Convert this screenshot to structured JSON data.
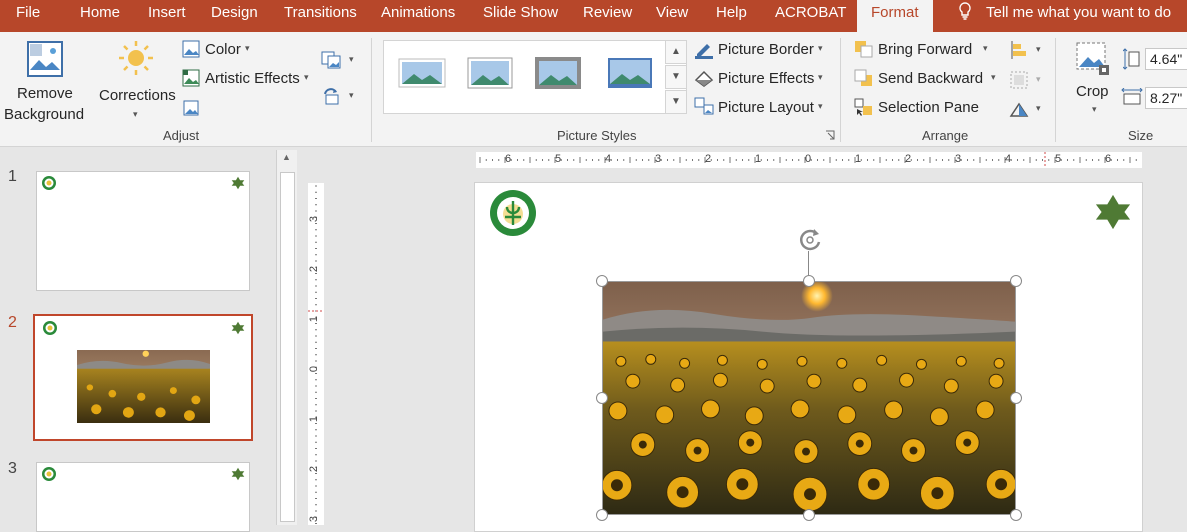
{
  "tabs": [
    "File",
    "Home",
    "Insert",
    "Design",
    "Transitions",
    "Animations",
    "Slide Show",
    "Review",
    "View",
    "Help",
    "ACROBAT"
  ],
  "active_tab": "Format",
  "tell_me": "Tell me what you want to do",
  "adjust": {
    "remove_bg_line1": "Remove",
    "remove_bg_line2": "Background",
    "corrections": "Corrections",
    "color": "Color",
    "artistic_effects": "Artistic Effects",
    "group_label": "Adjust"
  },
  "picture_styles": {
    "border": "Picture Border",
    "effects": "Picture Effects",
    "layout": "Picture Layout",
    "group_label": "Picture Styles"
  },
  "arrange": {
    "bring_forward": "Bring Forward",
    "send_backward": "Send Backward",
    "selection_pane": "Selection Pane",
    "group_label": "Arrange"
  },
  "size": {
    "crop": "Crop",
    "height": "4.64\"",
    "width": "8.27\"",
    "group_label": "Size"
  },
  "slides": [
    {
      "number": "1",
      "has_picture": false
    },
    {
      "number": "2",
      "has_picture": true
    },
    {
      "number": "3",
      "has_picture": false
    }
  ],
  "hruler_labels": [
    "6",
    "5",
    "4",
    "3",
    "2",
    "1",
    "0",
    "1",
    "2",
    "3",
    "4",
    "5",
    "6"
  ],
  "vruler_labels": [
    "3",
    "2",
    "1",
    "0",
    "1",
    "2",
    "3"
  ],
  "colors": {
    "accent": "#b7472a",
    "star": "#4f7a34",
    "logo": "#2a8a3a"
  }
}
